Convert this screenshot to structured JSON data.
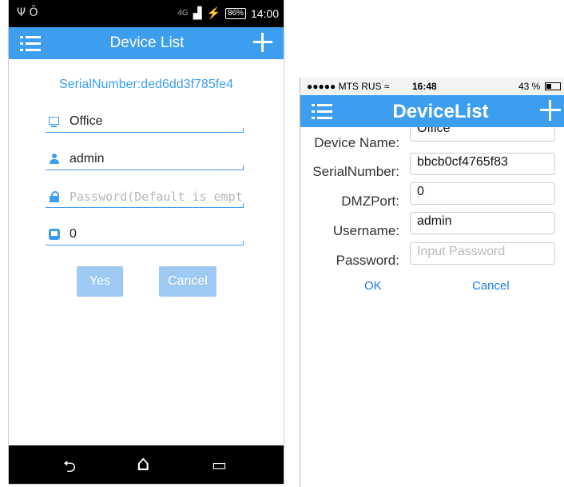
{
  "android": {
    "status": {
      "left_icons": "Ψ  Ӧ",
      "network": "4G",
      "battery": "86%",
      "time": "14:00"
    },
    "title": "Device List",
    "serial": "SerialNumber:ded6dd3f785fe4",
    "fields": {
      "name": "Office",
      "username": "admin",
      "password_placeholder": "Password(Default is empty)",
      "port": "0"
    },
    "buttons": {
      "yes": "Yes",
      "cancel": "Cancel"
    },
    "nav": {
      "back": "⮌",
      "home": "⌂",
      "recent": "▭"
    },
    "colors": {
      "accent": "#3d9ef0",
      "button": "#9ec9f2"
    }
  },
  "ios": {
    "status": {
      "carrier": "●●●●● MTS RUS ≈",
      "time": "16:48",
      "battery": "43 %"
    },
    "title": "DeviceList",
    "form": {
      "device_name_label": "Device Name:",
      "device_name_value": "Office",
      "serial_label": "SerialNumber:",
      "serial_value": "bbcb0cf4765f83",
      "dmz_label": "DMZPort:",
      "dmz_value": "0",
      "username_label": "Username:",
      "username_value": "admin",
      "password_label": "Password:",
      "password_placeholder": "Input Password"
    },
    "buttons": {
      "ok": "OK",
      "cancel": "Cancel"
    },
    "colors": {
      "accent": "#3d9ef0",
      "link": "#1a7ee6"
    }
  }
}
